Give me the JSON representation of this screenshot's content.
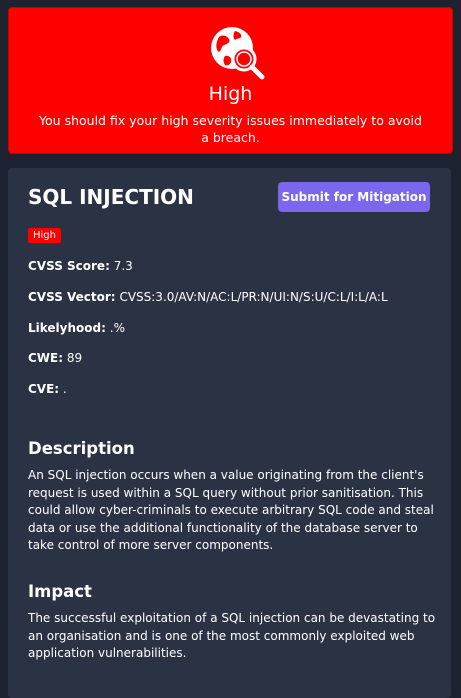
{
  "alert": {
    "icon": "globe-search-icon",
    "title": "High",
    "message": "You should fix your high severity issues immediately to avoid a breach.",
    "color": "#ff0000"
  },
  "vulnerability": {
    "title": "SQL INJECTION",
    "submit_label": "Submit for Mitigation",
    "severity_badge": "High",
    "fields": {
      "cvss_score_label": "CVSS Score:",
      "cvss_score_value": "7.3",
      "cvss_vector_label": "CVSS Vector:",
      "cvss_vector_value": "CVSS:3.0/AV:N/AC:L/PR:N/UI:N/S:U/C:L/I:L/A:L",
      "likelyhood_label": "Likelyhood:",
      "likelyhood_value": ".%",
      "cwe_label": "CWE:",
      "cwe_value": "89",
      "cve_label": "CVE:",
      "cve_value": "."
    },
    "description_heading": "Description",
    "description_text": "An SQL injection occurs when a value originating from the client's request is used within a SQL query without prior sanitisation. This could allow cyber-criminals to execute arbitrary SQL code and steal data or use the additional functionality of the database server to take control of more server components.",
    "impact_heading": "Impact",
    "impact_text": "The successful exploitation of a SQL injection can be devastating to an organisation and is one of the most commonly exploited web application vulnerabilities."
  },
  "colors": {
    "page_background": "#1c2230",
    "card_background": "#2b3244",
    "button_accent": "#7b67ee",
    "severity_high": "#ff0000"
  }
}
